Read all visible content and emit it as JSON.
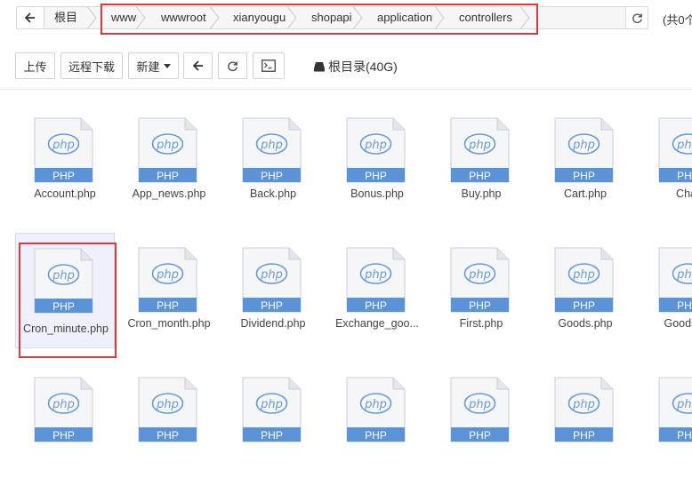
{
  "path": {
    "back_icon": "arrow-left-icon",
    "root_label": "根目录",
    "crumbs": [
      "www",
      "wwwroot",
      "xianyougu",
      "shopapi",
      "application",
      "controllers"
    ],
    "refresh_icon": "refresh-icon",
    "total_label": "(共0个"
  },
  "toolbar": {
    "upload_label": "上传",
    "remote_download_label": "远程下载",
    "new_label": "新建",
    "back_icon": "arrow-left-icon",
    "refresh_icon": "refresh-icon",
    "terminal_icon": "terminal-icon",
    "disk_label": "根目录(40G)",
    "disk_icon": "hard-drive-icon"
  },
  "file_badge": "PHP",
  "file_icon_text": "php",
  "files": [
    {
      "name": "Account.php"
    },
    {
      "name": "App_news.php"
    },
    {
      "name": "Back.php"
    },
    {
      "name": "Bonus.php"
    },
    {
      "name": "Buy.php"
    },
    {
      "name": "Cart.php"
    },
    {
      "name": "Chat."
    },
    {
      "name": "Cron_minute.php"
    },
    {
      "name": "Cron_month.php"
    },
    {
      "name": "Dividend.php"
    },
    {
      "name": "Exchange_goo..."
    },
    {
      "name": "First.php"
    },
    {
      "name": "Goods.php"
    },
    {
      "name": "Goods_ca"
    },
    {
      "name": ""
    },
    {
      "name": ""
    },
    {
      "name": ""
    },
    {
      "name": ""
    },
    {
      "name": ""
    },
    {
      "name": ""
    },
    {
      "name": ""
    }
  ],
  "colors": {
    "accent_blue": "#4a90e2",
    "highlight_red": "#d9393d",
    "selected_bg": "#eef1fb"
  }
}
